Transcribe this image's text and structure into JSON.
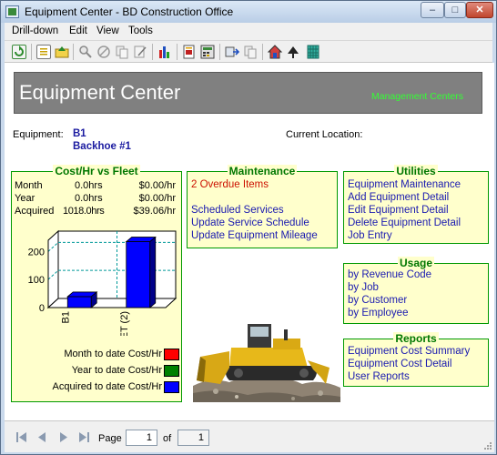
{
  "window": {
    "title": "Equipment Center - BD Construction Office",
    "controls": {
      "minimize": "–",
      "maximize": "□",
      "close": "✕"
    }
  },
  "menu": [
    "Drill-down",
    "Edit",
    "View",
    "Tools"
  ],
  "toolbar_icons": [
    "refresh-icon",
    "document-icon",
    "up-folder-icon",
    "zoom-icon",
    "no-entry-icon",
    "copy-icon",
    "edit-icon",
    "bar-chart-icon",
    "report-icon",
    "calculator-icon",
    "export-icon",
    "print-preview-icon",
    "home-icon",
    "map-pin-icon",
    "grid-icon"
  ],
  "banner": {
    "title": "Equipment Center",
    "link": "Management Centers"
  },
  "equipment": {
    "label": "Equipment:",
    "code": "B1",
    "name": "Backhoe #1",
    "location_label": "Current Location:",
    "location_value": ""
  },
  "cost_panel": {
    "title": "Cost/Hr vs Fleet",
    "rows": [
      {
        "label": "Month",
        "hours": "0.0hrs",
        "rate": "$0.00/hr"
      },
      {
        "label": "Year",
        "hours": "0.0hrs",
        "rate": "$0.00/hr"
      },
      {
        "label": "Acquired",
        "hours": "1018.0hrs",
        "rate": "$39.06/hr"
      }
    ],
    "legend": [
      {
        "label": "Month to date Cost/Hr",
        "color": "#ff0000"
      },
      {
        "label": "Year to date Cost/Hr",
        "color": "#008000"
      },
      {
        "label": "Acquired to date Cost/Hr",
        "color": "#0000ff"
      }
    ]
  },
  "chart_data": {
    "type": "bar",
    "categories": [
      "B1",
      "FLEET (2)"
    ],
    "series": [
      {
        "name": "Month to date Cost/Hr",
        "color": "#ff0000",
        "values": [
          0,
          0
        ]
      },
      {
        "name": "Year to date Cost/Hr",
        "color": "#008000",
        "values": [
          0,
          0
        ]
      },
      {
        "name": "Acquired to date Cost/Hr",
        "color": "#0000ff",
        "values": [
          39.06,
          235
        ]
      }
    ],
    "yticks": [
      0,
      100,
      200
    ],
    "ylim": [
      0,
      240
    ],
    "grid": true,
    "legend_position": "bottom-right"
  },
  "maintenance": {
    "title": "Maintenance",
    "overdue": "2 Overdue Items",
    "links": [
      "Scheduled Services",
      "Update Service Schedule",
      "Update Equipment Mileage"
    ]
  },
  "utilities": {
    "title": "Utilities",
    "links": [
      "Equipment Maintenance",
      "Add Equipment Detail",
      "Edit Equipment Detail",
      "Delete Equipment Detail",
      "Job Entry"
    ]
  },
  "usage": {
    "title": "Usage",
    "links": [
      "by Revenue Code",
      "by Job",
      "by Customer",
      "by Employee"
    ]
  },
  "reports": {
    "title": "Reports",
    "links": [
      "Equipment Cost Summary",
      "Equipment Cost Detail",
      "User Reports"
    ]
  },
  "pager": {
    "page_label": "Page",
    "current_page": "1",
    "of_label": "of",
    "total_pages": "1"
  }
}
